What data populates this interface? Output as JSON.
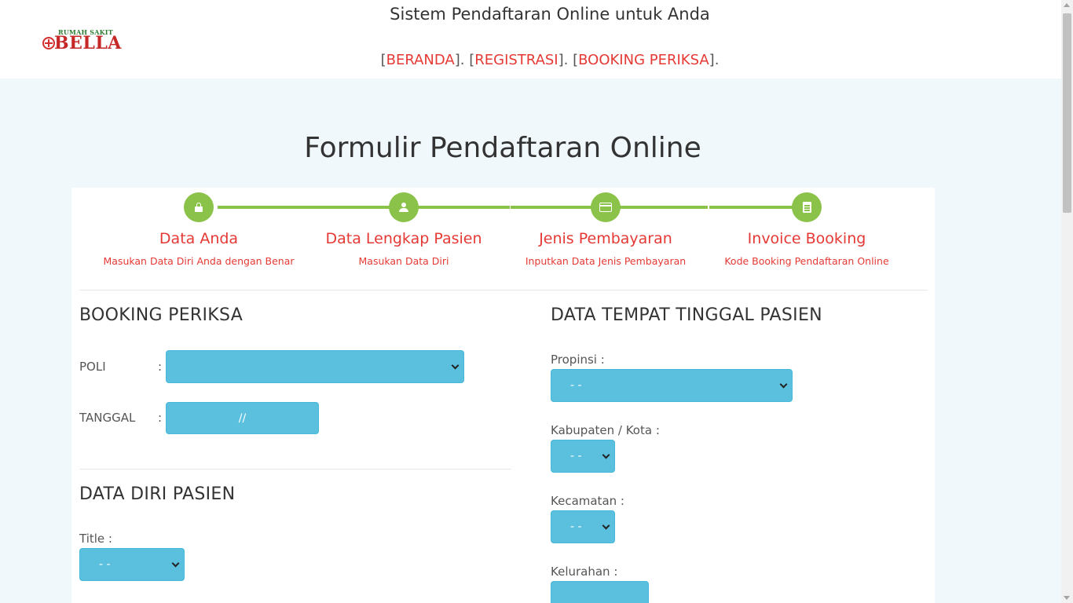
{
  "header": {
    "logo": {
      "small": "RUMAH SAKIT",
      "big": "BELLA"
    },
    "site_title": "Sistem Pendaftaran Online untuk Anda",
    "nav": [
      {
        "label": "BERANDA"
      },
      {
        "label": "REGISTRASI"
      },
      {
        "label": "BOOKING PERIKSA"
      }
    ]
  },
  "page": {
    "title": "Formulir Pendaftaran Online"
  },
  "steps": [
    {
      "title": "Data Anda",
      "subtitle": "Masukan Data Diri Anda dengan Benar",
      "icon": "lock-icon"
    },
    {
      "title": "Data Lengkap Pasien",
      "subtitle": "Masukan Data Diri",
      "icon": "user-icon"
    },
    {
      "title": "Jenis Pembayaran",
      "subtitle": "Inputkan Data Jenis Pembayaran",
      "icon": "credit-card-icon"
    },
    {
      "title": "Invoice Booking",
      "subtitle": "Kode Booking Pendaftaran Online",
      "icon": "document-icon"
    }
  ],
  "booking": {
    "title": "BOOKING PERIKSA",
    "poli_label": "POLI",
    "poli_value": "",
    "tanggal_label": "TANGGAL",
    "tanggal_value": "//",
    "colon": ":"
  },
  "data_diri": {
    "title": "DATA DIRI PASIEN",
    "title_label": "Title :",
    "title_value": "- -"
  },
  "tempat_tinggal": {
    "title": "DATA TEMPAT TINGGAL PASIEN",
    "propinsi_label": "Propinsi :",
    "propinsi_value": "- -",
    "kabupaten_label": "Kabupaten / Kota :",
    "kabupaten_value": "- -",
    "kecamatan_label": "Kecamatan :",
    "kecamatan_value": "- -",
    "kelurahan_label": "Kelurahan :",
    "kelurahan_value": ""
  },
  "colors": {
    "accent_red": "#e53935",
    "step_green": "#8bc34a",
    "field_blue": "#5bc0de",
    "page_bg": "#f0f8fc"
  }
}
